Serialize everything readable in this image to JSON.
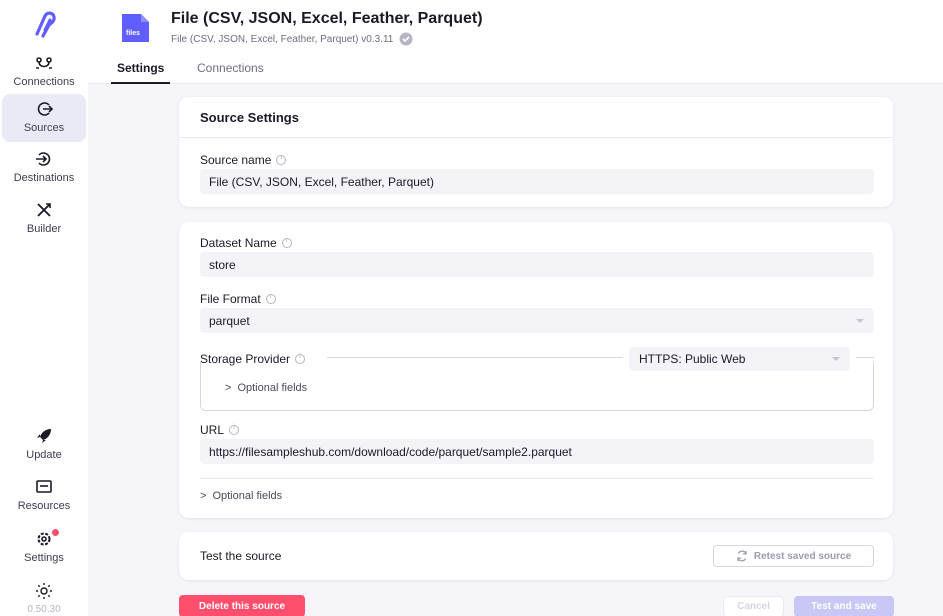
{
  "sidebar": {
    "items": [
      {
        "label": "Connections",
        "icon": "connections-icon"
      },
      {
        "label": "Sources",
        "icon": "sources-icon"
      },
      {
        "label": "Destinations",
        "icon": "destinations-icon"
      },
      {
        "label": "Builder",
        "icon": "builder-icon"
      }
    ],
    "bottom_items": [
      {
        "label": "Update",
        "icon": "rocket-icon"
      },
      {
        "label": "Resources",
        "icon": "resources-icon"
      },
      {
        "label": "Settings",
        "icon": "gear-icon"
      }
    ],
    "version": "0.50.30"
  },
  "header": {
    "icon_text": "files",
    "title": "File (CSV, JSON, Excel, Feather, Parquet)",
    "subtitle": "File (CSV, JSON, Excel, Feather, Parquet) v0.3.11",
    "tabs": [
      {
        "label": "Settings",
        "active": true
      },
      {
        "label": "Connections",
        "active": false
      }
    ]
  },
  "source_settings": {
    "title": "Source Settings",
    "source_name_label": "Source name",
    "source_name_value": "File (CSV, JSON, Excel, Feather, Parquet)"
  },
  "config": {
    "dataset_name_label": "Dataset Name",
    "dataset_name_value": "store",
    "file_format_label": "File Format",
    "file_format_value": "parquet",
    "storage_provider_label": "Storage Provider",
    "storage_provider_value": "HTTPS: Public Web",
    "storage_optional_fields": "Optional fields",
    "url_label": "URL",
    "url_value": "https://filesampleshub.com/download/code/parquet/sample2.parquet",
    "optional_fields": "Optional fields"
  },
  "test": {
    "title": "Test the source",
    "retest_label": "Retest saved source"
  },
  "footer": {
    "delete_label": "Delete this source",
    "cancel_label": "Cancel",
    "save_label": "Test and save"
  },
  "colors": {
    "accent": "#615eff",
    "danger": "#ff4f6d",
    "save_disabled": "#c9c7f6",
    "active_nav": "#eaeaf7"
  }
}
